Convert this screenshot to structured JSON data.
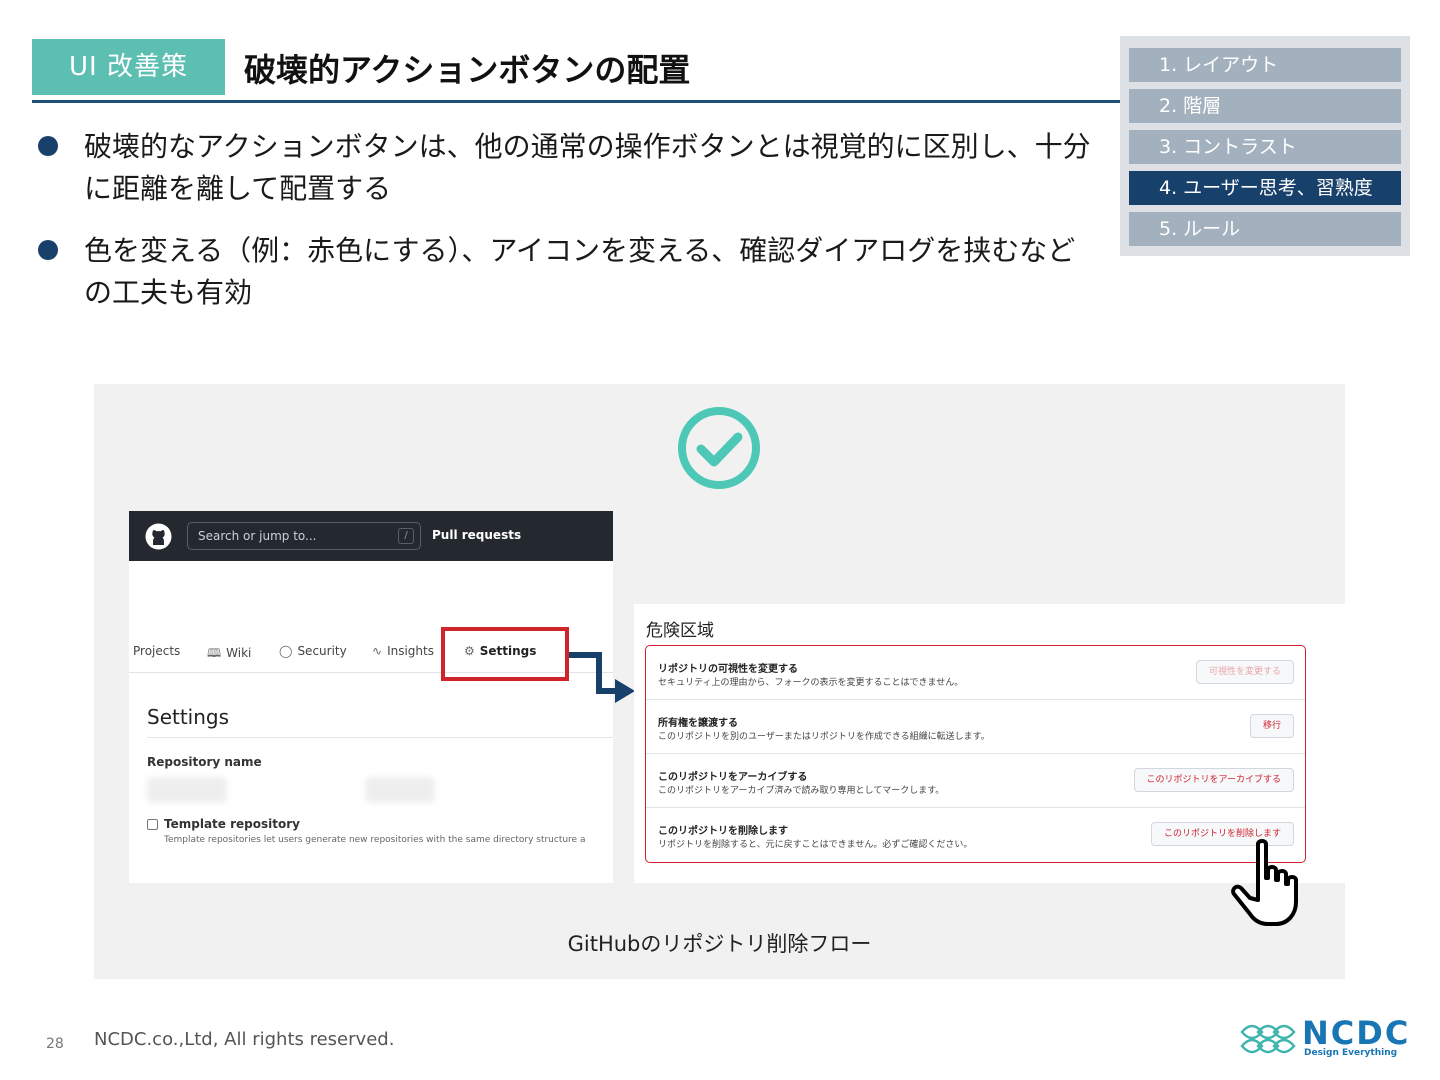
{
  "header": {
    "tag": "UI 改善策",
    "title": "破壊的アクションボタンの配置"
  },
  "toc": {
    "items": [
      {
        "label": "1. レイアウト",
        "active": false
      },
      {
        "label": "2. 階層",
        "active": false
      },
      {
        "label": "3. コントラスト",
        "active": false
      },
      {
        "label": "4. ユーザー思考、習熟度",
        "active": true
      },
      {
        "label": "5. ルール",
        "active": false
      }
    ]
  },
  "bullets": [
    "破壊的なアクションボタンは、他の通常の操作ボタンとは視覚的に区別し、十分に距離を離して配置する",
    "色を変える（例：赤色にする）、アイコンを変える、確認ダイアログを挟むなどの工夫も有効"
  ],
  "figure": {
    "caption": "GitHubのリポジトリ削除フロー",
    "github": {
      "search_placeholder": "Search or jump to...",
      "slash_key": "/",
      "pull_requests": "Pull requests",
      "tabs": [
        {
          "label": "Projects",
          "icon": ""
        },
        {
          "label": "Wiki",
          "icon": "book-icon"
        },
        {
          "label": "Security",
          "icon": "shield-icon"
        },
        {
          "label": "Insights",
          "icon": "graph-icon"
        },
        {
          "label": "Settings",
          "icon": "gear-icon"
        }
      ],
      "settings_heading": "Settings",
      "repo_name_label": "Repository name",
      "template_label": "Template repository",
      "template_desc": "Template repositories let users generate new repositories with the same directory structure a"
    },
    "danger_zone": {
      "title": "危険区域",
      "rows": [
        {
          "title": "リポジトリの可視性を変更する",
          "desc": "セキュリティ上の理由から、フォークの表示を変更することはできません。",
          "button": "可視性を変更する",
          "disabled": true
        },
        {
          "title": "所有権を譲渡する",
          "desc": "このリポジトリを別のユーザーまたはリポジトリを作成できる組織に転送します。",
          "button": "移行",
          "disabled": false
        },
        {
          "title": "このリポジトリをアーカイブする",
          "desc": "このリポジトリをアーカイブ済みで読み取り専用としてマークします。",
          "button": "このリポジトリをアーカイブする",
          "disabled": false
        },
        {
          "title": "このリポジトリを削除します",
          "desc": "リポジトリを削除すると、元に戻すことはできません。必ずご確認ください。",
          "button": "このリポジトリを削除します",
          "disabled": false
        }
      ]
    }
  },
  "footer": {
    "page_number": "28",
    "copyright": "NCDC.co.,Ltd, All rights reserved.",
    "logo_text": "NCDC",
    "logo_sub": "Design Everything"
  },
  "colors": {
    "accent_teal": "#5cbfb2",
    "navy": "#17406b",
    "danger_red": "#cf222e",
    "toc_inactive": "#a3b1be"
  }
}
